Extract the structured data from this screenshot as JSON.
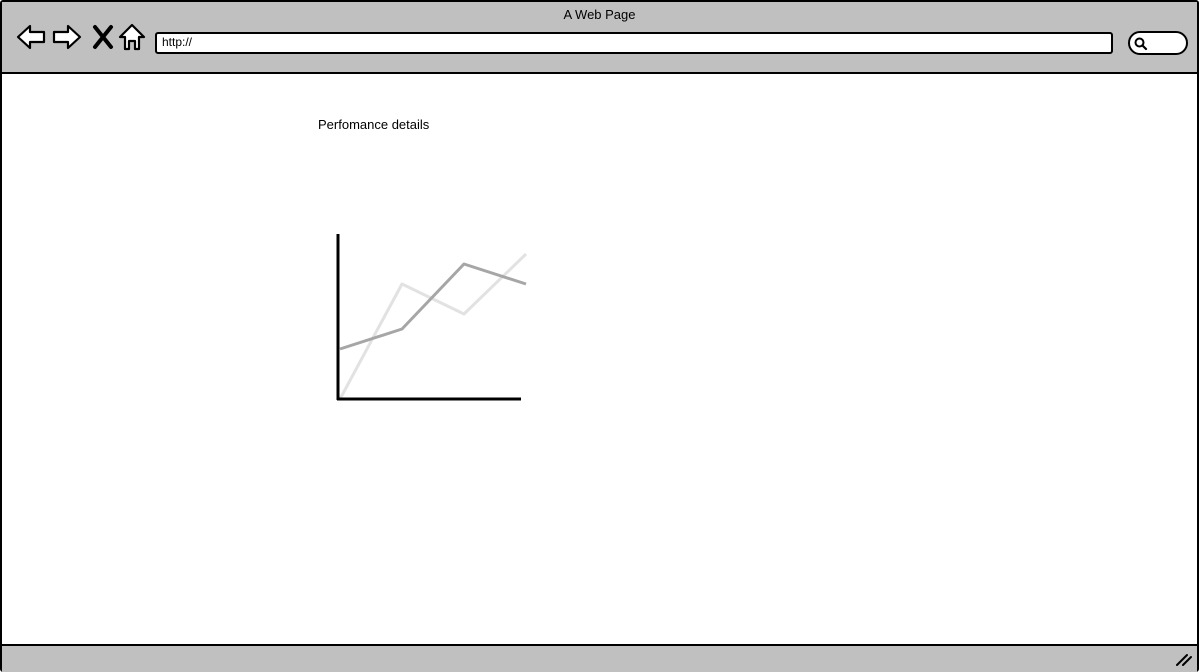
{
  "window": {
    "title": "A Web Page"
  },
  "toolbar": {
    "back_icon": "back-arrow-icon",
    "forward_icon": "forward-arrow-icon",
    "stop_icon": "close-x-icon",
    "home_icon": "home-icon"
  },
  "address_bar": {
    "value": "http://"
  },
  "search": {
    "icon": "search-icon"
  },
  "page": {
    "heading": "Perfomance details"
  },
  "colors": {
    "chrome": "#c0c0c0",
    "series_dark": "#a6a6a6",
    "series_light": "#e2e2e2",
    "axis": "#000000"
  },
  "chart_data": {
    "type": "line",
    "x": [
      0,
      1,
      2,
      3
    ],
    "series": [
      {
        "values": [
          10,
          14,
          27,
          23
        ]
      },
      {
        "values": [
          0,
          23,
          17,
          29
        ]
      }
    ],
    "ylim": [
      0,
      30
    ],
    "grid": false,
    "legend": "none"
  }
}
